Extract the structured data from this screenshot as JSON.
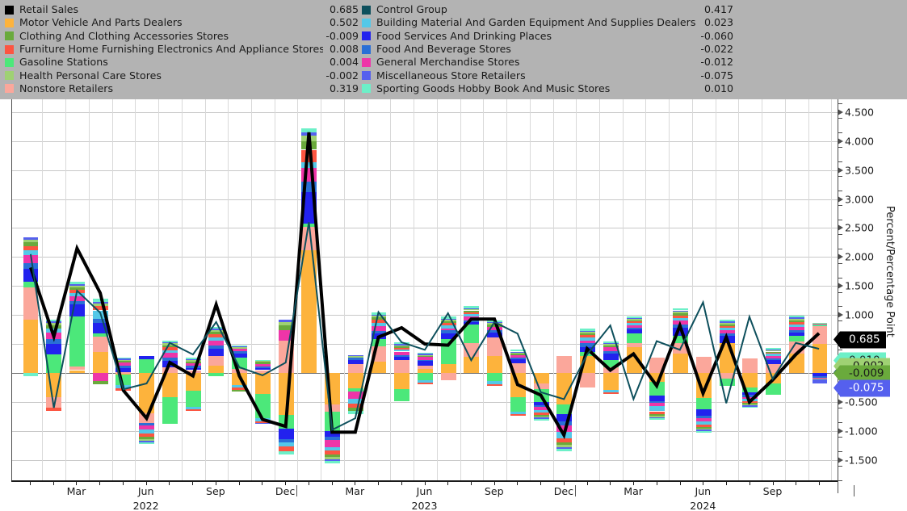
{
  "legend": {
    "background": "#b3b3b3",
    "left_column": [
      {
        "label": "Retail Sales",
        "value": "0.685",
        "color": "#000000"
      },
      {
        "label": "Motor Vehicle And Parts Dealers",
        "value": "0.502",
        "color": "#fdb33c"
      },
      {
        "label": "Clothing And Clothing Accessories Stores",
        "value": "-0.009",
        "color": "#6aaa3c"
      },
      {
        "label": "Furniture Home Furnishing Electronics And Appliance Stores",
        "value": "0.008",
        "color": "#fc5541"
      },
      {
        "label": "Gasoline Stations",
        "value": "0.004",
        "color": "#4ce87a"
      },
      {
        "label": "Health Personal Care Stores",
        "value": "-0.002",
        "color": "#9fd173"
      },
      {
        "label": "Nonstore Retailers",
        "value": "0.319",
        "color": "#fba79b"
      }
    ],
    "right_column": [
      {
        "label": "Control Group",
        "value": "0.417",
        "color": "#0d4f5c"
      },
      {
        "label": "Building Material And Garden Equipment And Supplies Dealers",
        "value": "0.023",
        "color": "#54c8e8"
      },
      {
        "label": "Food Services And Drinking Places",
        "value": "-0.060",
        "color": "#2222ee"
      },
      {
        "label": "Food And Beverage Stores",
        "value": "-0.022",
        "color": "#2a6fd6"
      },
      {
        "label": "General Merchandise Stores",
        "value": "-0.012",
        "color": "#ee35a8"
      },
      {
        "label": "Miscellaneous Store Retailers",
        "value": "-0.075",
        "color": "#5560ee"
      },
      {
        "label": "Sporting Goods Hobby Book And Music Stores",
        "value": "0.010",
        "color": "#6df0c8"
      }
    ]
  },
  "axes": {
    "y_title": "Percent/Percentage Point",
    "y_ticks": [
      "4.500",
      "4.000",
      "3.500",
      "3.000",
      "2.500",
      "2.000",
      "1.500",
      "1.000",
      "0.500",
      "0.000",
      "-0.500",
      "-1.000",
      "-1.500"
    ],
    "y_min": -1.85,
    "y_max": 4.72,
    "x_labels": [
      {
        "text": "Mar",
        "index": 2
      },
      {
        "text": "Jun",
        "index": 5
      },
      {
        "text": "Sep",
        "index": 8
      },
      {
        "text": "Dec",
        "index": 11
      },
      {
        "text": "Mar",
        "index": 14
      },
      {
        "text": "Jun",
        "index": 17
      },
      {
        "text": "Sep",
        "index": 20
      },
      {
        "text": "Dec",
        "index": 23
      },
      {
        "text": "Mar",
        "index": 26
      },
      {
        "text": "Jun",
        "index": 29
      },
      {
        "text": "Sep",
        "index": 32
      }
    ],
    "x_years": [
      {
        "text": "2022",
        "index": 5
      },
      {
        "text": "2023",
        "index": 17
      },
      {
        "text": "2024",
        "index": 29
      }
    ],
    "year_boundaries": [
      11,
      23,
      35
    ]
  },
  "value_tags": [
    {
      "name": "sporting-goods",
      "value": "0.010",
      "y": 0.01,
      "bg": "#6df0c8",
      "fg": "#1a1a1a",
      "offset": -14
    },
    {
      "name": "retail-sales",
      "value": "0.685",
      "y": 0.685,
      "bg": "#000000",
      "fg": "#ffffff",
      "offset": 8
    },
    {
      "name": "control-group",
      "value": "0.417",
      "y": 0.417,
      "bg": "#0d4f5c",
      "fg": "#cfe8ee",
      "offset": 30
    },
    {
      "name": "health-care",
      "value": "-0.002",
      "y": -0.002,
      "bg": "#9fd173",
      "fg": "#1a1a1a",
      "offset": -8
    },
    {
      "name": "clothing",
      "value": "-0.009",
      "y": -0.009,
      "bg": "#6aaa3c",
      "fg": "#1a1a1a",
      "offset": 0
    },
    {
      "name": "misc-retailers",
      "value": "-0.075",
      "y": -0.075,
      "bg": "#5560ee",
      "fg": "#ffffff",
      "offset": 14
    }
  ],
  "chart_data": {
    "type": "bar",
    "title": "",
    "xlabel": "",
    "ylabel": "Percent/Percentage Point",
    "ylim": [
      -1.85,
      4.72
    ],
    "grid": true,
    "stacked": true,
    "legend_position": "top",
    "categories": [
      "2022-01",
      "2022-02",
      "2022-03",
      "2022-04",
      "2022-05",
      "2022-06",
      "2022-07",
      "2022-08",
      "2022-09",
      "2022-10",
      "2022-11",
      "2022-12",
      "2023-01",
      "2023-02",
      "2023-03",
      "2023-04",
      "2023-05",
      "2023-06",
      "2023-07",
      "2023-08",
      "2023-09",
      "2023-10",
      "2023-11",
      "2023-12",
      "2024-01",
      "2024-02",
      "2024-03",
      "2024-04",
      "2024-05",
      "2024-06",
      "2024-07",
      "2024-08",
      "2024-09",
      "2024-10",
      "2024-11"
    ],
    "line_series": [
      {
        "name": "Retail Sales",
        "color": "#000000",
        "width": 4,
        "values": [
          1.82,
          0.63,
          2.15,
          1.38,
          -0.3,
          -0.78,
          0.18,
          -0.05,
          1.18,
          -0.05,
          -0.8,
          -0.92,
          4.15,
          -1.02,
          -1.02,
          0.62,
          0.78,
          0.5,
          0.48,
          0.93,
          0.93,
          -0.2,
          -0.38,
          -1.07,
          0.42,
          0.05,
          0.33,
          -0.22,
          0.82,
          -0.35,
          0.62,
          -0.5,
          -0.12,
          0.32,
          0.685
        ]
      },
      {
        "name": "Control Group",
        "color": "#0d4f5c",
        "width": 2,
        "values": [
          2.05,
          -0.6,
          1.42,
          1.04,
          -0.28,
          -0.18,
          0.52,
          0.32,
          0.88,
          0.1,
          -0.04,
          0.18,
          2.6,
          -0.98,
          -0.78,
          1.05,
          0.53,
          0.4,
          1.03,
          0.22,
          0.88,
          0.68,
          -0.33,
          -0.45,
          0.32,
          0.82,
          -0.45,
          0.55,
          0.4,
          1.22,
          -0.52,
          0.97,
          -0.1,
          0.52,
          0.417
        ]
      }
    ],
    "series": [
      {
        "name": "Motor Vehicle And Parts Dealers",
        "color": "#fdb33c",
        "last_value": 0.502,
        "values": [
          0.92,
          -0.42,
          0.05,
          0.36,
          -0.02,
          -0.69,
          -0.42,
          -0.3,
          0.12,
          -0.21,
          -0.36,
          -0.72,
          2.12,
          -0.54,
          -0.27,
          0.19,
          -0.28,
          0.07,
          0.15,
          0.28,
          0.3,
          -0.42,
          -0.18,
          -0.54,
          0.3,
          -0.29,
          0.45,
          -0.15,
          0.33,
          -0.43,
          0.52,
          -0.25,
          -0.18,
          0.34,
          0.502
        ]
      },
      {
        "name": "Nonstore Retailers",
        "color": "#fba79b",
        "last_value": 0.319,
        "values": [
          0.55,
          -0.18,
          0.06,
          0.27,
          0.01,
          -0.17,
          0.1,
          0.05,
          0.17,
          0.07,
          0.05,
          0.56,
          0.4,
          -0.13,
          0.16,
          0.27,
          0.22,
          0.06,
          -0.13,
          0.23,
          0.31,
          0.17,
          -0.1,
          0.3,
          -0.25,
          0.1,
          0.06,
          0.27,
          0.18,
          0.28,
          -0.09,
          0.25,
          0.15,
          0.2,
          0.319
        ]
      },
      {
        "name": "Gasoline Stations",
        "color": "#4ce87a",
        "last_value": 0.004,
        "values": [
          0.1,
          0.32,
          0.86,
          0.05,
          -0.19,
          0.24,
          -0.45,
          -0.29,
          -0.06,
          0.2,
          -0.42,
          -0.24,
          0.05,
          -0.33,
          -0.05,
          0.13,
          -0.21,
          -0.13,
          0.44,
          0.32,
          -0.14,
          -0.25,
          -0.22,
          -0.17,
          0.06,
          0.13,
          0.18,
          -0.24,
          0.13,
          -0.2,
          -0.13,
          -0.08,
          -0.19,
          0.1,
          0.004
        ]
      },
      {
        "name": "Food Services And Drinking Places",
        "color": "#2222ee",
        "last_value": -0.06,
        "values": [
          0.22,
          0.18,
          0.22,
          0.19,
          0.08,
          0.05,
          0.11,
          0.04,
          0.13,
          0.07,
          0.04,
          -0.18,
          0.55,
          -0.1,
          0.06,
          0.09,
          0.06,
          0.08,
          0.1,
          0.05,
          0.09,
          0.07,
          -0.05,
          -0.13,
          0.09,
          0.11,
          0.06,
          -0.09,
          0.14,
          -0.11,
          0.12,
          -0.05,
          0.07,
          0.06,
          -0.06
        ]
      },
      {
        "name": "Food And Beverage Stores",
        "color": "#2a6fd6",
        "last_value": -0.022,
        "values": [
          0.11,
          0.08,
          0.05,
          0.07,
          0.03,
          -0.04,
          0.06,
          0.03,
          0.05,
          0.04,
          0.02,
          -0.05,
          0.18,
          -0.06,
          0.04,
          0.05,
          0.03,
          0.02,
          0.05,
          0.03,
          0.04,
          0.03,
          -0.03,
          -0.06,
          0.06,
          0.04,
          0.03,
          -0.04,
          0.05,
          -0.04,
          0.04,
          -0.03,
          0.03,
          0.04,
          -0.022
        ]
      },
      {
        "name": "General Merchandise Stores",
        "color": "#ee35a8",
        "last_value": -0.012,
        "values": [
          0.13,
          0.12,
          0.09,
          -0.14,
          0.06,
          -0.08,
          0.08,
          0.05,
          0.09,
          0.04,
          0.05,
          0.18,
          0.23,
          -0.12,
          -0.13,
          0.08,
          0.06,
          0.05,
          0.03,
          0.07,
          0.06,
          0.04,
          -0.06,
          -0.11,
          0.05,
          0.07,
          0.04,
          -0.05,
          0.07,
          -0.06,
          0.06,
          -0.04,
          0.05,
          0.05,
          -0.012
        ]
      },
      {
        "name": "Building Material And Garden Equipment And Supplies Dealers",
        "color": "#54c8e8",
        "last_value": 0.023,
        "values": [
          0.09,
          0.07,
          0.05,
          0.14,
          -0.05,
          -0.06,
          0.04,
          -0.04,
          0.06,
          -0.04,
          -0.05,
          -0.07,
          0.1,
          -0.05,
          -0.08,
          0.06,
          0.03,
          -0.04,
          0.05,
          0.04,
          -0.05,
          -0.04,
          -0.04,
          -0.11,
          0.05,
          -0.04,
          0.04,
          -0.09,
          0.05,
          -0.05,
          0.04,
          -0.04,
          0.03,
          0.05,
          0.023
        ]
      },
      {
        "name": "Furniture Home Furnishing Electronics And Appliance Stores",
        "color": "#fc5541",
        "last_value": 0.008,
        "values": [
          0.07,
          -0.06,
          0.06,
          0.08,
          -0.04,
          -0.06,
          0.05,
          -0.03,
          0.05,
          -0.04,
          -0.03,
          -0.09,
          0.22,
          -0.07,
          -0.07,
          0.05,
          0.03,
          -0.03,
          0.04,
          0.03,
          -0.03,
          -0.03,
          -0.04,
          -0.07,
          0.04,
          -0.03,
          0.03,
          -0.05,
          0.04,
          -0.04,
          0.03,
          -0.03,
          0.02,
          0.04,
          0.008
        ]
      },
      {
        "name": "Clothing And Clothing Accessories Stores",
        "color": "#6aaa3c",
        "last_value": -0.009,
        "values": [
          0.06,
          0.05,
          0.04,
          -0.05,
          0.03,
          -0.04,
          0.04,
          0.03,
          0.04,
          -0.03,
          0.03,
          0.08,
          0.14,
          -0.05,
          -0.05,
          0.04,
          0.03,
          0.02,
          0.03,
          0.03,
          0.03,
          0.02,
          -0.03,
          -0.05,
          0.03,
          0.03,
          0.02,
          -0.03,
          0.04,
          -0.03,
          0.03,
          -0.02,
          0.02,
          0.03,
          -0.009
        ]
      },
      {
        "name": "Health Personal Care Stores",
        "color": "#9fd173",
        "last_value": -0.002,
        "values": [
          0.05,
          0.04,
          0.03,
          0.04,
          0.02,
          -0.03,
          0.03,
          0.02,
          0.03,
          0.02,
          0.02,
          0.06,
          0.1,
          -0.04,
          0.03,
          0.03,
          0.02,
          0.02,
          0.03,
          0.02,
          0.03,
          0.02,
          -0.02,
          -0.04,
          0.03,
          0.02,
          0.02,
          -0.02,
          0.03,
          -0.02,
          0.03,
          -0.02,
          0.02,
          0.03,
          -0.002
        ]
      },
      {
        "name": "Miscellaneous Store Retailers",
        "color": "#5560ee",
        "last_value": -0.075,
        "values": [
          0.04,
          0.03,
          0.02,
          0.03,
          0.02,
          -0.02,
          0.02,
          0.02,
          0.02,
          0.02,
          -0.02,
          0.04,
          0.06,
          -0.03,
          0.02,
          0.02,
          0.02,
          0.01,
          0.02,
          0.02,
          0.02,
          0.02,
          -0.02,
          -0.03,
          0.02,
          0.02,
          0.02,
          -0.02,
          0.02,
          -0.02,
          0.02,
          -0.02,
          0.02,
          0.02,
          -0.075
        ]
      },
      {
        "name": "Sporting Goods Hobby Book And Music Stores",
        "color": "#6df0c8",
        "last_value": 0.01,
        "values": [
          -0.05,
          0.03,
          0.04,
          0.05,
          0.02,
          -0.03,
          0.03,
          0.03,
          0.04,
          0.02,
          0.02,
          -0.06,
          0.07,
          -0.04,
          -0.06,
          0.04,
          0.03,
          0.02,
          0.03,
          0.03,
          0.03,
          0.03,
          -0.03,
          -0.04,
          0.03,
          0.03,
          0.02,
          -0.03,
          0.04,
          -0.03,
          0.03,
          -0.02,
          0.02,
          0.03,
          0.01
        ]
      }
    ]
  }
}
